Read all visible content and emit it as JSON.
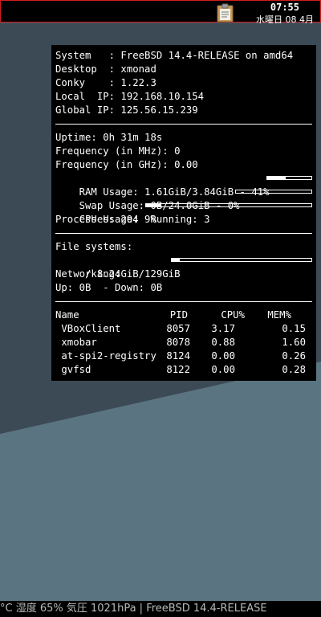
{
  "topbar": {
    "time": "07:55",
    "date": "水曜日 08 4月"
  },
  "icons": {
    "clipboard": "clipboard-icon"
  },
  "conky": {
    "system_info": [
      "System   : FreeBSD 14.4-RELEASE on amd64",
      "Desktop  : xmonad",
      "Conky    : 1.22.3",
      "Local  IP: 192.168.10.154",
      "Global IP: 125.56.15.239"
    ],
    "uptime": "Uptime: 0h 31m 18s",
    "freq_mhz": "Frequency (in MHz): 0",
    "freq_ghz": "Frequency (in GHz): 0.00",
    "ram": {
      "text": "RAM Usage: 1.61GiB/3.84GiB - 41%",
      "percent": 41
    },
    "swap": {
      "text": "Swap Usage: 0B/24.0GiB - 0%",
      "percent": 0
    },
    "cpu": {
      "text": "CPU Usage: 9%",
      "percent": 9
    },
    "processes": "Processes: 294  Running: 3",
    "fs_header": "File systems:",
    "fs_root": {
      "text": " / 8.24GiB/129GiB",
      "percent": 6
    },
    "net_header": "Networking:",
    "net_updown": "Up: 0B  - Down: 0B",
    "proc_headers": {
      "name": "Name",
      "pid": "PID",
      "cpu": "CPU%",
      "mem": "MEM%"
    },
    "processes_table": [
      {
        "name": " VBoxClient",
        "pid": "8057",
        "cpu": "3.17",
        "mem": "0.15"
      },
      {
        "name": " xmobar",
        "pid": "8078",
        "cpu": "0.88",
        "mem": "1.60"
      },
      {
        "name": " at-spi2-registry",
        "pid": "8124",
        "cpu": "0.00",
        "mem": "0.26"
      },
      {
        "name": " gvfsd",
        "pid": "8122",
        "cpu": "0.00",
        "mem": "0.28"
      }
    ]
  },
  "bottombar": {
    "text": "°C 湿度 65% 気圧 1021hPa | FreeBSD 14.4-RELEASE"
  }
}
